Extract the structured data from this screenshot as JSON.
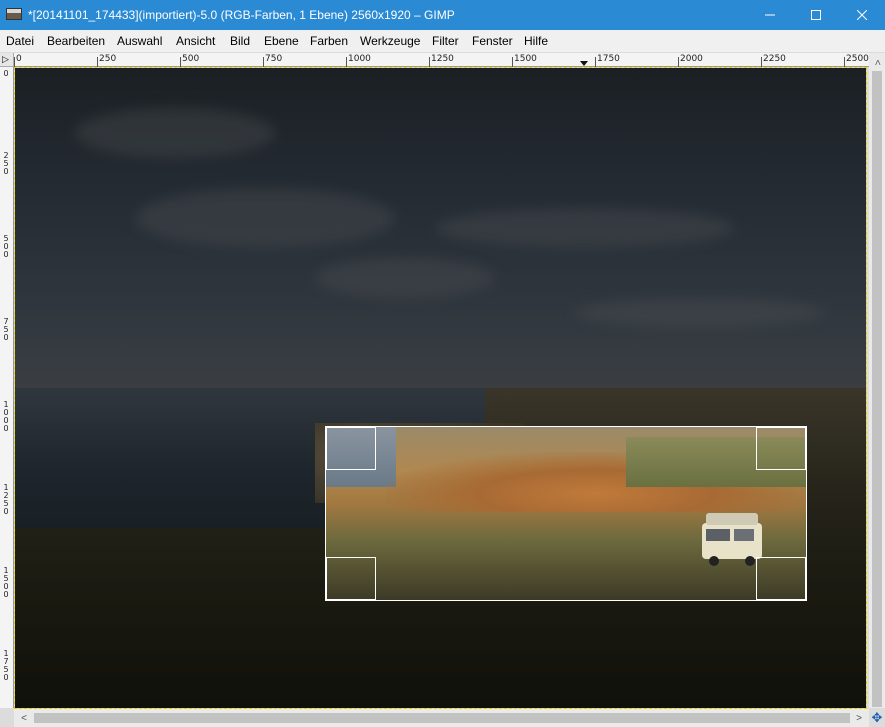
{
  "window": {
    "title": "*[20141101_174433](importiert)-5.0 (RGB-Farben, 1 Ebene) 2560x1920 – GIMP",
    "minimize_icon": "minimize-icon",
    "maximize_icon": "maximize-icon",
    "close_icon": "close-icon"
  },
  "menu": [
    {
      "label": "Datei"
    },
    {
      "label": "Bearbeiten"
    },
    {
      "label": "Auswahl"
    },
    {
      "label": "Ansicht"
    },
    {
      "label": "Bild"
    },
    {
      "label": "Ebene"
    },
    {
      "label": "Farben"
    },
    {
      "label": "Werkzeuge"
    },
    {
      "label": "Filter"
    },
    {
      "label": "Fenster"
    },
    {
      "label": "Hilfe"
    }
  ],
  "hruler": [
    "0",
    "250",
    "500",
    "750",
    "1000",
    "1250",
    "1500",
    "1750",
    "2000",
    "2250",
    "2500"
  ],
  "vruler": [
    "0",
    "250",
    "500",
    "750",
    "1000",
    "1250",
    "1500",
    "1750"
  ],
  "colors": {
    "titlebar": "#2b8ad4",
    "selection_border": "#ffffff",
    "canvas_boundary": "#e6d300"
  },
  "icons": {
    "ruler_corner": "ruler-toggle-icon",
    "navigate": "navigate-icon"
  },
  "corner_glyph": "▷",
  "nav_glyph": "✥",
  "scroll_left": "<",
  "scroll_right": ">",
  "scroll_up": "<"
}
